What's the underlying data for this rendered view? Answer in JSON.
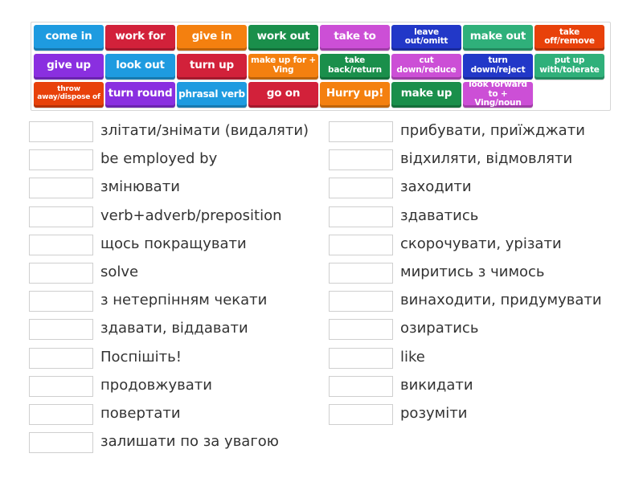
{
  "tiles": [
    {
      "label": "come in",
      "color": "#1e9be0",
      "size": "big"
    },
    {
      "label": "work for",
      "color": "#d2213a",
      "size": "big"
    },
    {
      "label": "give in",
      "color": "#f4800f",
      "size": "big"
    },
    {
      "label": "work out",
      "color": "#1a8f4b",
      "size": "big"
    },
    {
      "label": "take to",
      "color": "#cc4fd6",
      "size": "big"
    },
    {
      "label": "leave out/omitt",
      "color": "#2238c8",
      "size": "small"
    },
    {
      "label": "make out",
      "color": "#2fb07a",
      "size": "big"
    },
    {
      "label": "take off/remove",
      "color": "#e8410a",
      "size": "small"
    },
    {
      "label": "give up",
      "color": "#8a2fe0",
      "size": "big"
    },
    {
      "label": "look out",
      "color": "#1e9be0",
      "size": "big"
    },
    {
      "label": "turn up",
      "color": "#d2213a",
      "size": "big"
    },
    {
      "label": "make up for + Ving",
      "color": "#f4800f",
      "size": "small"
    },
    {
      "label": "take back/return",
      "color": "#1a8f4b",
      "size": "small"
    },
    {
      "label": "cut down/reduce",
      "color": "#cc4fd6",
      "size": "small"
    },
    {
      "label": "turn down/reject",
      "color": "#2238c8",
      "size": "small"
    },
    {
      "label": "put up with/tolerate",
      "color": "#2fb07a",
      "size": "small"
    },
    {
      "label": "throw away/dispose of",
      "color": "#e8410a",
      "size": "tiny"
    },
    {
      "label": "turn round",
      "color": "#8a2fe0",
      "size": "big"
    },
    {
      "label": "phrasal verb",
      "color": "#1e9be0",
      "size": "med"
    },
    {
      "label": "go on",
      "color": "#d2213a",
      "size": "big"
    },
    {
      "label": "Hurry up!",
      "color": "#f4800f",
      "size": "big"
    },
    {
      "label": "make up",
      "color": "#1a8f4b",
      "size": "big"
    },
    {
      "label": "look forward to + Ving/noun",
      "color": "#cc4fd6",
      "size": "small"
    }
  ],
  "definitions_left": [
    "злітати/знімати (видаляти)",
    "be employed by",
    "змінювати",
    "verb+adverb/preposition",
    "щось покращувати",
    "solve",
    "з нетерпінням чекати",
    "здавати, віддавати",
    "Поспішіть!",
    "продовжувати",
    "повертати",
    "залишати по за увагою"
  ],
  "definitions_right": [
    "прибувати, приїжджати",
    "відхиляти, відмовляти",
    "заходити",
    "здаватись",
    "скорочувати, урізати",
    "миритись з чимось",
    "винаходити, придумувати",
    "озиратись",
    "like",
    "викидати",
    "розуміти"
  ]
}
